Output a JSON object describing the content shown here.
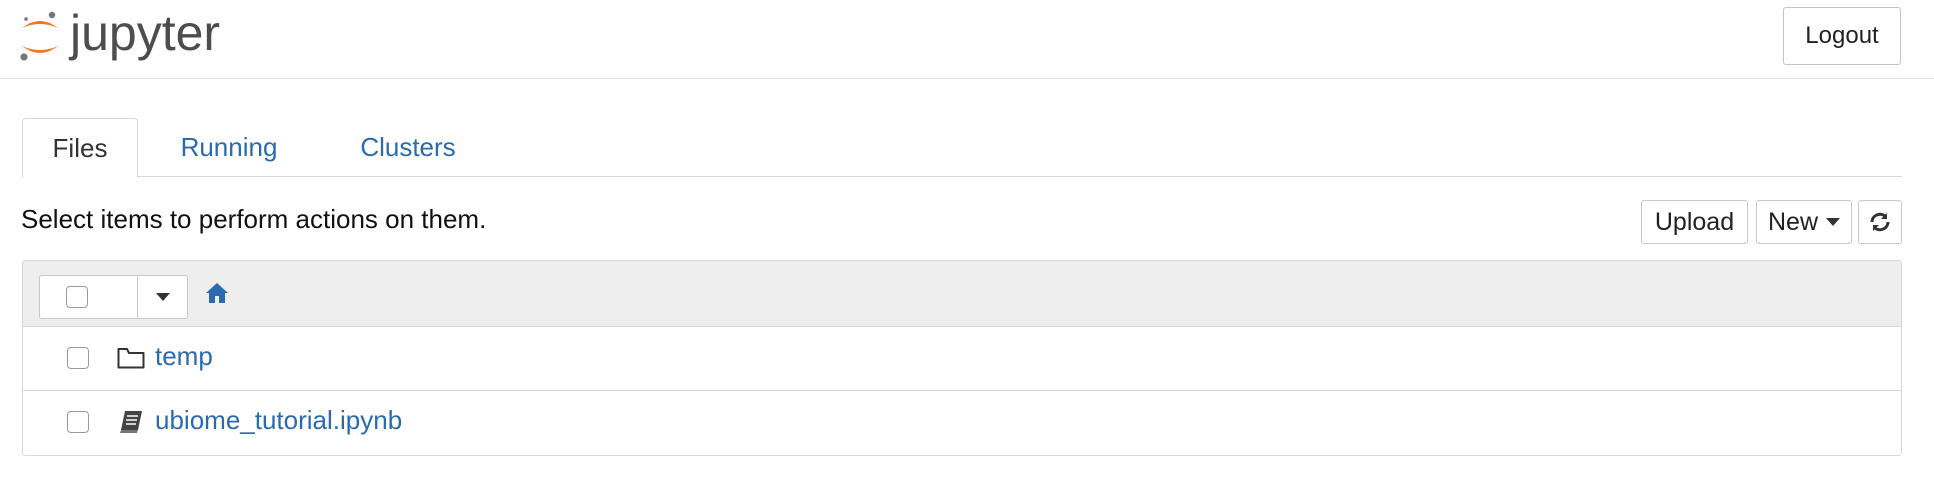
{
  "header": {
    "logo_text": "jupyter",
    "logout_label": "Logout"
  },
  "tabs": [
    {
      "label": "Files",
      "active": true
    },
    {
      "label": "Running",
      "active": false
    },
    {
      "label": "Clusters",
      "active": false
    }
  ],
  "toolbar": {
    "hint": "Select items to perform actions on them.",
    "upload_label": "Upload",
    "new_label": "New",
    "refresh_icon": "refresh-icon"
  },
  "file_list": {
    "header": {
      "select_all_checked": false,
      "home_icon": "home-icon"
    },
    "rows": [
      {
        "name": "temp",
        "type": "folder",
        "icon": "folder-icon"
      },
      {
        "name": "ubiome_tutorial.ipynb",
        "type": "notebook",
        "icon": "notebook-icon"
      }
    ]
  },
  "colors": {
    "brand_orange": "#F37726",
    "link_blue": "#2a6bb0",
    "logo_gray": "#4d4d4d"
  }
}
